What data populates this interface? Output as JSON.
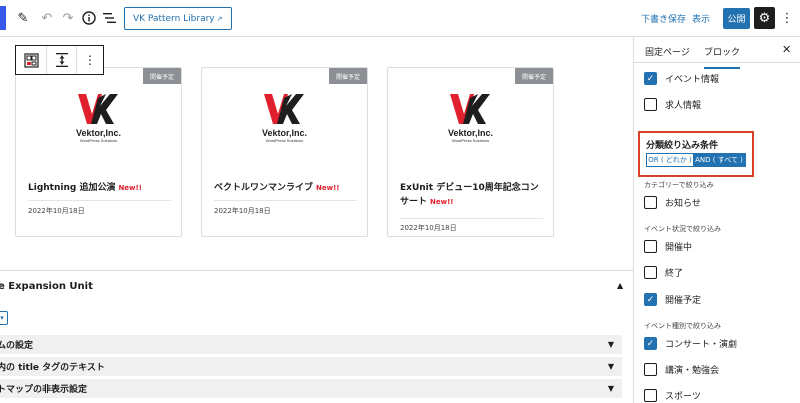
{
  "toolbar": {
    "pattern_library_label": "VK Pattern Library",
    "external_mark": "↗",
    "save_draft_label": "下書き保存",
    "preview_label": "表示",
    "publish_label": "公開"
  },
  "cards": [
    {
      "badge": "開催予定",
      "logo_name": "Vektor,Inc.",
      "logo_sub": "WordPress Solutions",
      "title": "Lightning 追加公演",
      "new": "New!!",
      "date": "2022年10月18日"
    },
    {
      "badge": "開催予定",
      "logo_name": "Vektor,Inc.",
      "logo_sub": "WordPress Solutions",
      "title": "ベクトルワンマンライブ",
      "new": "New!!",
      "date": "2022年10月18日"
    },
    {
      "badge": "開催予定",
      "logo_name": "Vektor,Inc.",
      "logo_sub": "WordPress Solutions",
      "title": "ExUnit デビュー10周年記念コンサート",
      "new": "New!!",
      "date": "2022年10月18日"
    }
  ],
  "panel": {
    "title": "e Expansion Unit",
    "rows": [
      "ムの設定",
      "内の title タグのテキスト",
      "トマップの非表示設定"
    ]
  },
  "sidebar": {
    "tab_page": "固定ページ",
    "tab_block": "ブロック",
    "top_items": [
      {
        "label": "イベント情報",
        "checked": true
      },
      {
        "label": "求人情報",
        "checked": false
      }
    ],
    "condition": {
      "title": "分類絞り込み条件",
      "or_label": "OR ( どれか )",
      "and_label": "AND ( すべて )",
      "selected": "AND"
    },
    "category_section": "カテゴリーで絞り込み",
    "category_items": [
      {
        "label": "お知らせ",
        "checked": false
      }
    ],
    "status_section": "イベント状況で絞り込み",
    "status_items": [
      {
        "label": "開催中",
        "checked": false
      },
      {
        "label": "終了",
        "checked": false
      },
      {
        "label": "開催予定",
        "checked": true
      }
    ],
    "type_section": "イベント種別で絞り込み",
    "type_items": [
      {
        "label": "コンサート・演劇",
        "checked": true
      },
      {
        "label": "講演・勉強会",
        "checked": false
      },
      {
        "label": "スポーツ",
        "checked": false
      }
    ]
  },
  "colors": {
    "accent": "#2271b1",
    "highlight": "#d9412b",
    "badge": "#8c8f94",
    "new": "#e0202c"
  }
}
